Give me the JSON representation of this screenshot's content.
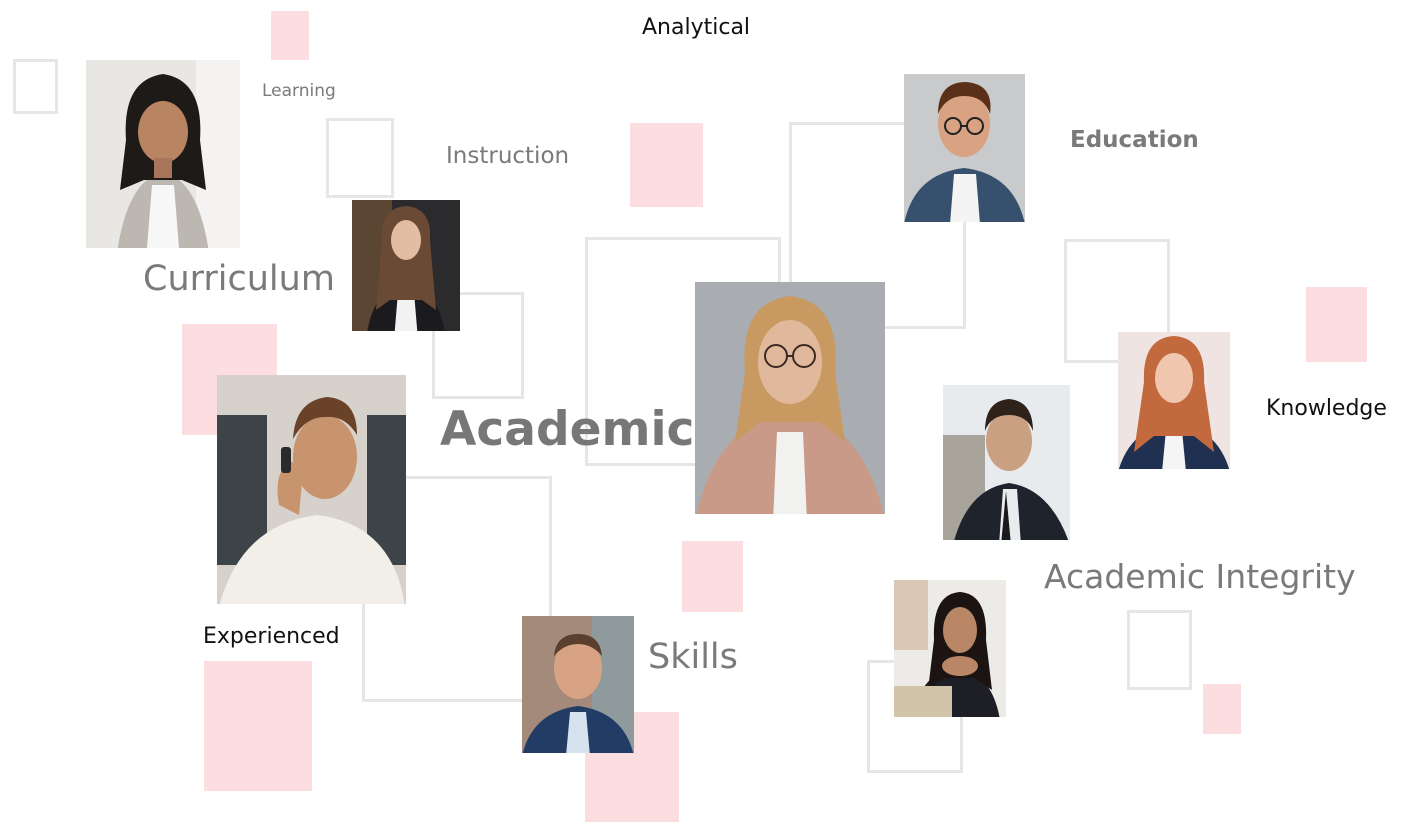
{
  "words": {
    "analytical": "Analytical",
    "learning": "Learning",
    "instruction": "Instruction",
    "education": "Education",
    "curriculum": "Curriculum",
    "academic": "Academic",
    "knowledge": "Knowledge",
    "academic_integrity": "Academic Integrity",
    "experienced": "Experienced",
    "skills": "Skills"
  },
  "colors": {
    "pink": "#fcdee0",
    "frame": "#e6e6e6",
    "text_gray": "#7a7a7a",
    "text_dark": "#111111"
  },
  "portraits": [
    "portrait-woman-plaid-blazer",
    "portrait-woman-long-hair",
    "portrait-man-glasses",
    "portrait-woman-blonde-glasses",
    "portrait-woman-red-hair",
    "portrait-man-suit",
    "portrait-man-phone",
    "portrait-man-bald-smiling",
    "portrait-woman-laptop"
  ]
}
